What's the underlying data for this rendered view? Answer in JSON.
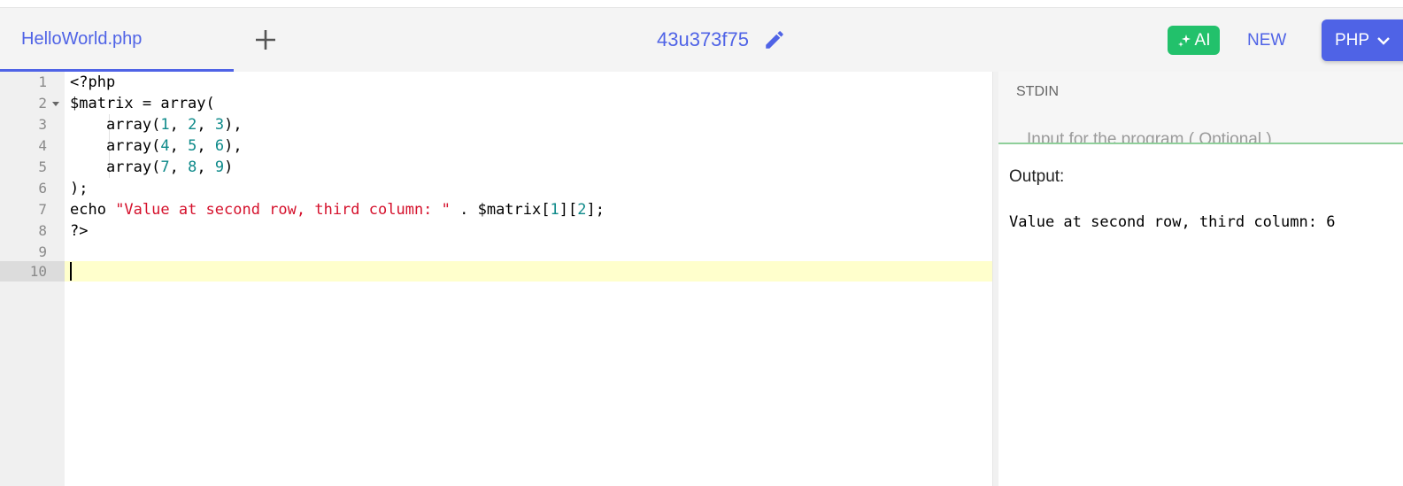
{
  "header": {
    "tab_label": "HelloWorld.php",
    "project_id": "43u373f75",
    "ai_label": "AI",
    "new_label": "NEW",
    "language_label": "PHP"
  },
  "editor": {
    "line_numbers": [
      "1",
      "2",
      "3",
      "4",
      "5",
      "6",
      "7",
      "8",
      "9",
      "10"
    ],
    "active_line": 10,
    "lines": {
      "l1": "<?php",
      "l2": "$matrix = array(",
      "l3a": "    array(",
      "l3n1": "1",
      "l3c1": ", ",
      "l3n2": "2",
      "l3c2": ", ",
      "l3n3": "3",
      "l3e": "),",
      "l4a": "    array(",
      "l4n1": "4",
      "l4c1": ", ",
      "l4n2": "5",
      "l4c2": ", ",
      "l4n3": "6",
      "l4e": "),",
      "l5a": "    array(",
      "l5n1": "7",
      "l5c1": ", ",
      "l5n2": "8",
      "l5c2": ", ",
      "l5n3": "9",
      "l5e": ")",
      "l6": ");",
      "l7a": "echo ",
      "l7s": "\"Value at second row, third column: \"",
      "l7b": " . $matrix[",
      "l7n1": "1",
      "l7c": "][",
      "l7n2": "2",
      "l7e": "];",
      "l8": "?>"
    }
  },
  "stdin": {
    "label": "STDIN",
    "placeholder": "Input for the program ( Optional )"
  },
  "output": {
    "label": "Output:",
    "text": "Value at second row, third column: 6"
  },
  "colors": {
    "accent": "#4f63e6",
    "ai_green": "#22c16b",
    "string": "#d5112c",
    "number": "#0e8a8a",
    "active_line": "#ffffcc"
  }
}
